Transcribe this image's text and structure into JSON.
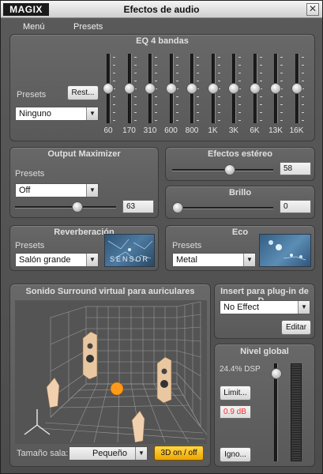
{
  "window": {
    "logo": "MAGIX",
    "title": "Efectos de audio",
    "close": "✕"
  },
  "menu": {
    "items": [
      "Menú",
      "Presets"
    ]
  },
  "eq": {
    "title": "EQ 4 bandas",
    "presets_label": "Presets",
    "reset_label": "Rest...",
    "preset_value": "Ninguno",
    "bands": [
      "60",
      "170",
      "310",
      "600",
      "800",
      "1K",
      "3K",
      "6K",
      "13K",
      "16K"
    ],
    "band_levels": [
      0.5,
      0.5,
      0.5,
      0.5,
      0.5,
      0.5,
      0.5,
      0.5,
      0.5,
      0.5
    ]
  },
  "maximizer": {
    "title": "Output Maximizer",
    "presets_label": "Presets",
    "preset_value": "Off",
    "value": "63",
    "level": 0.63
  },
  "stereo": {
    "title": "Efectos estéreo",
    "value": "58",
    "level": 0.58
  },
  "brillo": {
    "title": "Brillo",
    "value": "0",
    "level": 0.0
  },
  "reverb": {
    "title": "Reverberación",
    "presets_label": "Presets",
    "preset_value": "Salón grande",
    "thumb_text": "SENSOR"
  },
  "echo": {
    "title": "Eco",
    "presets_label": "Presets",
    "preset_value": "Metal"
  },
  "surround": {
    "title": "Sonido Surround virtual para auriculares",
    "room_label": "Tamaño sala:",
    "room_value": "Pequeño",
    "toggle_label": "3D on / off"
  },
  "insert": {
    "title": "Insert para plug-in de D...",
    "plugin_value": "No Effect",
    "edit_label": "Editar"
  },
  "global": {
    "title": "Nivel global",
    "dsp": "24.4% DSP",
    "limit_label": "Limit...",
    "db": "0.9 dB",
    "ignore_label": "Igno...",
    "level": 0.95
  },
  "colors": {
    "accent": "#f0a400",
    "db_text": "#ff2a2a"
  }
}
